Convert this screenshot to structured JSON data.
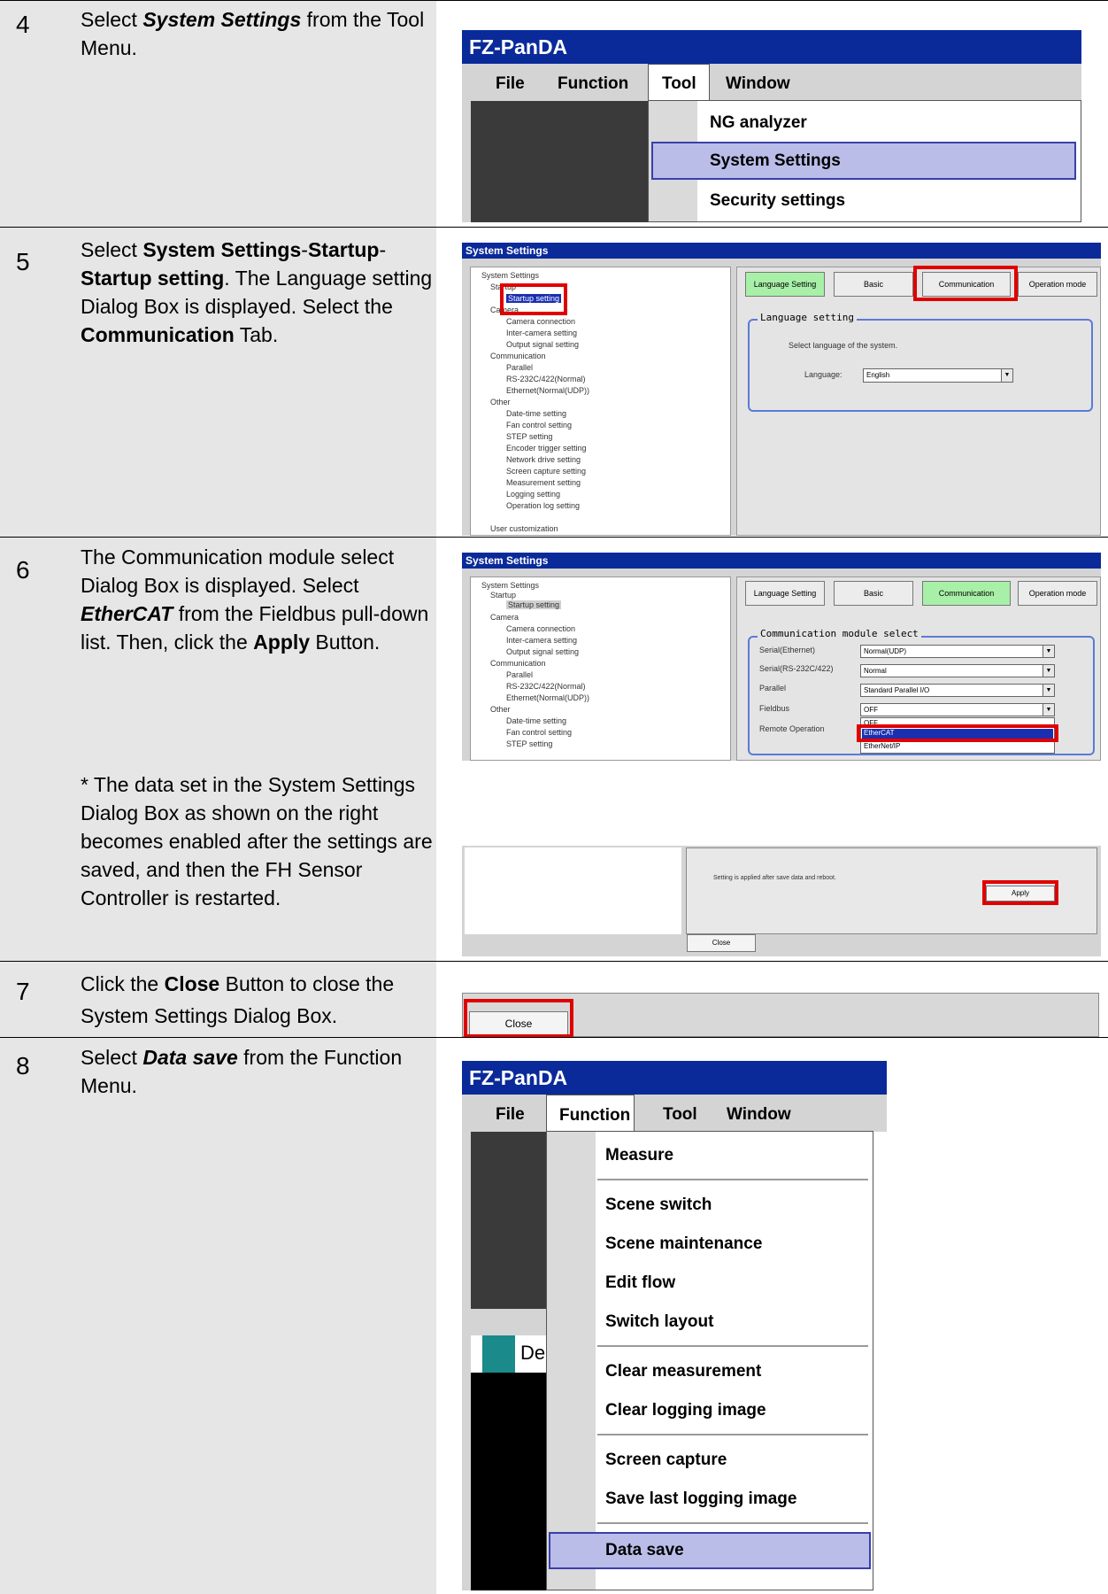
{
  "steps": [
    {
      "num": "4",
      "text": [
        "Select ",
        "System Settings",
        " from the Tool Menu."
      ]
    },
    {
      "num": "5",
      "text": [
        "Select ",
        "System Settings",
        "-",
        "Startup",
        "-",
        "Startup setting",
        ". The Language setting Dialog Box is displayed. Select the ",
        "Communication",
        " Tab."
      ]
    },
    {
      "num": "6",
      "text": [
        "The Communication module select Dialog Box is displayed. Select ",
        "EtherCAT",
        " from the Fieldbus pull-down list. Then, click the ",
        "Apply",
        " Button."
      ],
      "note": "* The data set in the System Settings Dialog Box as shown on the right becomes enabled after the settings are saved, and then the FH Sensor Controller is restarted."
    },
    {
      "num": "7",
      "text": [
        "Click the ",
        "Close",
        " Button to close the System Settings Dialog Box."
      ]
    },
    {
      "num": "8",
      "text": [
        "Select ",
        "Data save",
        " from the Function Menu."
      ]
    }
  ],
  "app": {
    "title": "FZ-PanDA",
    "menubar": [
      "File",
      "Function",
      "Tool",
      "Window"
    ]
  },
  "tool_menu": [
    "NG analyzer",
    "System Settings",
    "Security settings"
  ],
  "function_menu": [
    "Measure",
    "Scene switch",
    "Scene maintenance",
    "Edit flow",
    "Switch layout",
    "Clear measurement",
    "Clear logging image",
    "Screen capture",
    "Save last logging image",
    "Data save"
  ],
  "function_menu_partial_text": "De",
  "system_settings": {
    "title": "System Settings",
    "tree5": [
      "System Settings",
      "Startup",
      "Startup setting",
      "Camera",
      "Camera connection",
      "Inter-camera setting",
      "Output signal setting",
      "Communication",
      "Parallel",
      "RS-232C/422(Normal)",
      "Ethernet(Normal(UDP))",
      "Other",
      "Date-time setting",
      "Fan control setting",
      "STEP setting",
      "Encoder trigger setting",
      "Network drive setting",
      "Screen capture setting",
      "Measurement setting",
      "Logging setting",
      "Operation log setting",
      "User customization"
    ],
    "tree6": [
      "System Settings",
      "Startup",
      "Startup setting",
      "Camera",
      "Camera connection",
      "Inter-camera setting",
      "Output signal setting",
      "Communication",
      "Parallel",
      "RS-232C/422(Normal)",
      "Ethernet(Normal(UDP))",
      "Other",
      "Date-time setting",
      "Fan control setting",
      "STEP setting"
    ],
    "tabs": [
      "Language Setting",
      "Basic",
      "Communication",
      "Operation mode"
    ],
    "language": {
      "legend": "Language setting",
      "prompt": "Select language of the system.",
      "label": "Language:",
      "value": "English"
    },
    "comm": {
      "legend": "Communication module select",
      "rows": [
        {
          "label": "Serial(Ethernet)",
          "value": "Normal(UDP)"
        },
        {
          "label": "Serial(RS-232C/422)",
          "value": "Normal"
        },
        {
          "label": "Parallel",
          "value": "Standard Parallel I/O"
        },
        {
          "label": "Fieldbus",
          "value": "OFF"
        },
        {
          "label": "Remote Operation",
          "value": ""
        }
      ],
      "dropdown_options": [
        "OFF",
        "EtherCAT",
        "EtherNet/IP"
      ]
    },
    "apply_note": "Setting is applied after save data and reboot.",
    "apply_label": "Apply",
    "close_label": "Close"
  },
  "colors": {
    "title_bar": "#0a2a9a",
    "highlight": "#e00000",
    "active_tab": "#a8f0a8",
    "menu_selected": "#b9bde8"
  }
}
